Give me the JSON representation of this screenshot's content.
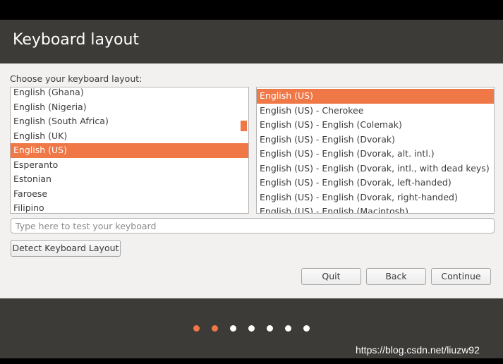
{
  "window": {
    "title": "Keyboard layout"
  },
  "prompt": "Choose your keyboard layout:",
  "layouts": [
    {
      "label": "English (Ghana)",
      "selected": false
    },
    {
      "label": "English (Nigeria)",
      "selected": false
    },
    {
      "label": "English (South Africa)",
      "selected": false
    },
    {
      "label": "English (UK)",
      "selected": false
    },
    {
      "label": "English (US)",
      "selected": true
    },
    {
      "label": "Esperanto",
      "selected": false
    },
    {
      "label": "Estonian",
      "selected": false
    },
    {
      "label": "Faroese",
      "selected": false
    },
    {
      "label": "Filipino",
      "selected": false
    }
  ],
  "variants": [
    {
      "label": "English (US)",
      "selected": true
    },
    {
      "label": "English (US) - Cherokee",
      "selected": false
    },
    {
      "label": "English (US) - English (Colemak)",
      "selected": false
    },
    {
      "label": "English (US) - English (Dvorak)",
      "selected": false
    },
    {
      "label": "English (US) - English (Dvorak, alt. intl.)",
      "selected": false
    },
    {
      "label": "English (US) - English (Dvorak, intl., with dead keys)",
      "selected": false
    },
    {
      "label": "English (US) - English (Dvorak, left-handed)",
      "selected": false
    },
    {
      "label": "English (US) - English (Dvorak, right-handed)",
      "selected": false
    },
    {
      "label": "English (US) - English (Macintosh)",
      "selected": false
    }
  ],
  "test_input": {
    "placeholder": "Type here to test your keyboard",
    "value": ""
  },
  "buttons": {
    "detect": "Detect Keyboard Layout",
    "quit": "Quit",
    "back": "Back",
    "continue": "Continue"
  },
  "progress": {
    "total_steps": 7,
    "current_step": 2
  },
  "watermark": "https://blog.csdn.net/liuzw92",
  "colors": {
    "accent": "#f07746",
    "header_bg": "#3c3b37",
    "content_bg": "#f2f1f0"
  }
}
